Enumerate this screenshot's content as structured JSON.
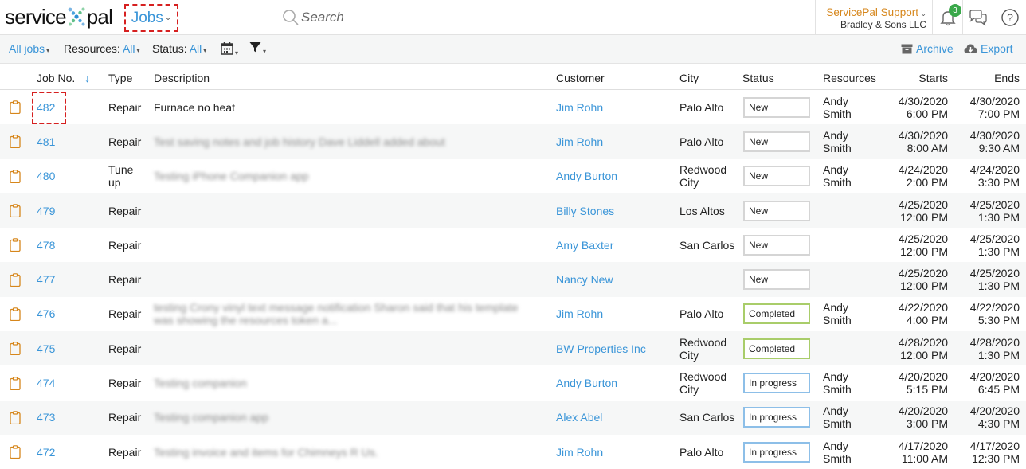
{
  "header": {
    "logo_left": "service",
    "logo_right": "pal",
    "jobs_menu_label": "Jobs",
    "search_placeholder": "Search",
    "account_name": "ServicePal Support",
    "account_company": "Bradley & Sons LLC",
    "notification_count": "3",
    "icons": [
      "add-icon",
      "bell-icon",
      "chat-icon",
      "help-icon"
    ],
    "accent": "#3a95d8",
    "account_color": "#d6861b"
  },
  "toolbar": {
    "all_jobs_label": "All jobs",
    "resources_label": "Resources:",
    "resources_value": "All",
    "status_label": "Status:",
    "status_value": "All",
    "archive_label": "Archive",
    "export_label": "Export"
  },
  "table": {
    "columns": {
      "job_no": "Job No.",
      "type": "Type",
      "description": "Description",
      "customer": "Customer",
      "city": "City",
      "status": "Status",
      "resources": "Resources",
      "starts": "Starts",
      "ends": "Ends"
    },
    "rows": [
      {
        "job": "482",
        "type": "Repair",
        "desc": "Furnace no heat",
        "desc_blurred": false,
        "customer": "Jim Rohn",
        "city": "Palo Alto",
        "status": "New",
        "resource": "Andy Smith",
        "start_date": "4/30/2020",
        "start_time": "6:00 PM",
        "end_date": "4/30/2020",
        "end_time": "7:00 PM"
      },
      {
        "job": "481",
        "type": "Repair",
        "desc": "Test saving notes and job history Dave Liddell added about",
        "desc_blurred": true,
        "customer": "Jim Rohn",
        "city": "Palo Alto",
        "status": "New",
        "resource": "Andy Smith",
        "start_date": "4/30/2020",
        "start_time": "8:00 AM",
        "end_date": "4/30/2020",
        "end_time": "9:30 AM"
      },
      {
        "job": "480",
        "type": "Tune up",
        "desc": "Testing iPhone Companion app",
        "desc_blurred": true,
        "customer": "Andy Burton",
        "city": "Redwood City",
        "status": "New",
        "resource": "Andy Smith",
        "start_date": "4/24/2020",
        "start_time": "2:00 PM",
        "end_date": "4/24/2020",
        "end_time": "3:30 PM"
      },
      {
        "job": "479",
        "type": "Repair",
        "desc": "",
        "desc_blurred": false,
        "customer": "Billy Stones",
        "city": "Los Altos",
        "status": "New",
        "resource": "",
        "start_date": "4/25/2020",
        "start_time": "12:00 PM",
        "end_date": "4/25/2020",
        "end_time": "1:30 PM"
      },
      {
        "job": "478",
        "type": "Repair",
        "desc": "",
        "desc_blurred": false,
        "customer": "Amy Baxter",
        "city": "San Carlos",
        "status": "New",
        "resource": "",
        "start_date": "4/25/2020",
        "start_time": "12:00 PM",
        "end_date": "4/25/2020",
        "end_time": "1:30 PM"
      },
      {
        "job": "477",
        "type": "Repair",
        "desc": "",
        "desc_blurred": false,
        "customer": "Nancy New",
        "city": "",
        "status": "New",
        "resource": "",
        "start_date": "4/25/2020",
        "start_time": "12:00 PM",
        "end_date": "4/25/2020",
        "end_time": "1:30 PM"
      },
      {
        "job": "476",
        "type": "Repair",
        "desc": "testing Crony vinyl text message notification Sharon said that his template was showing the resources token a...",
        "desc_blurred": true,
        "customer": "Jim Rohn",
        "city": "Palo Alto",
        "status": "Completed",
        "resource": "Andy Smith",
        "start_date": "4/22/2020",
        "start_time": "4:00 PM",
        "end_date": "4/22/2020",
        "end_time": "5:30 PM"
      },
      {
        "job": "475",
        "type": "Repair",
        "desc": "",
        "desc_blurred": false,
        "customer": "BW Properties Inc",
        "city": "Redwood City",
        "status": "Completed",
        "resource": "",
        "start_date": "4/28/2020",
        "start_time": "12:00 PM",
        "end_date": "4/28/2020",
        "end_time": "1:30 PM"
      },
      {
        "job": "474",
        "type": "Repair",
        "desc": "Testing companion",
        "desc_blurred": true,
        "customer": "Andy Burton",
        "city": "Redwood City",
        "status": "In progress",
        "resource": "Andy Smith",
        "start_date": "4/20/2020",
        "start_time": "5:15 PM",
        "end_date": "4/20/2020",
        "end_time": "6:45 PM"
      },
      {
        "job": "473",
        "type": "Repair",
        "desc": "Testing companion app",
        "desc_blurred": true,
        "customer": "Alex Abel",
        "city": "San Carlos",
        "status": "In progress",
        "resource": "Andy Smith",
        "start_date": "4/20/2020",
        "start_time": "3:00 PM",
        "end_date": "4/20/2020",
        "end_time": "4:30 PM"
      },
      {
        "job": "472",
        "type": "Repair",
        "desc": "Testing invoice and items for Chimneys R Us.",
        "desc_blurred": true,
        "customer": "Jim Rohn",
        "city": "Palo Alto",
        "status": "In progress",
        "resource": "Andy Smith",
        "start_date": "4/17/2020",
        "start_time": "11:00 AM",
        "end_date": "4/17/2020",
        "end_time": "12:30 PM"
      }
    ]
  }
}
